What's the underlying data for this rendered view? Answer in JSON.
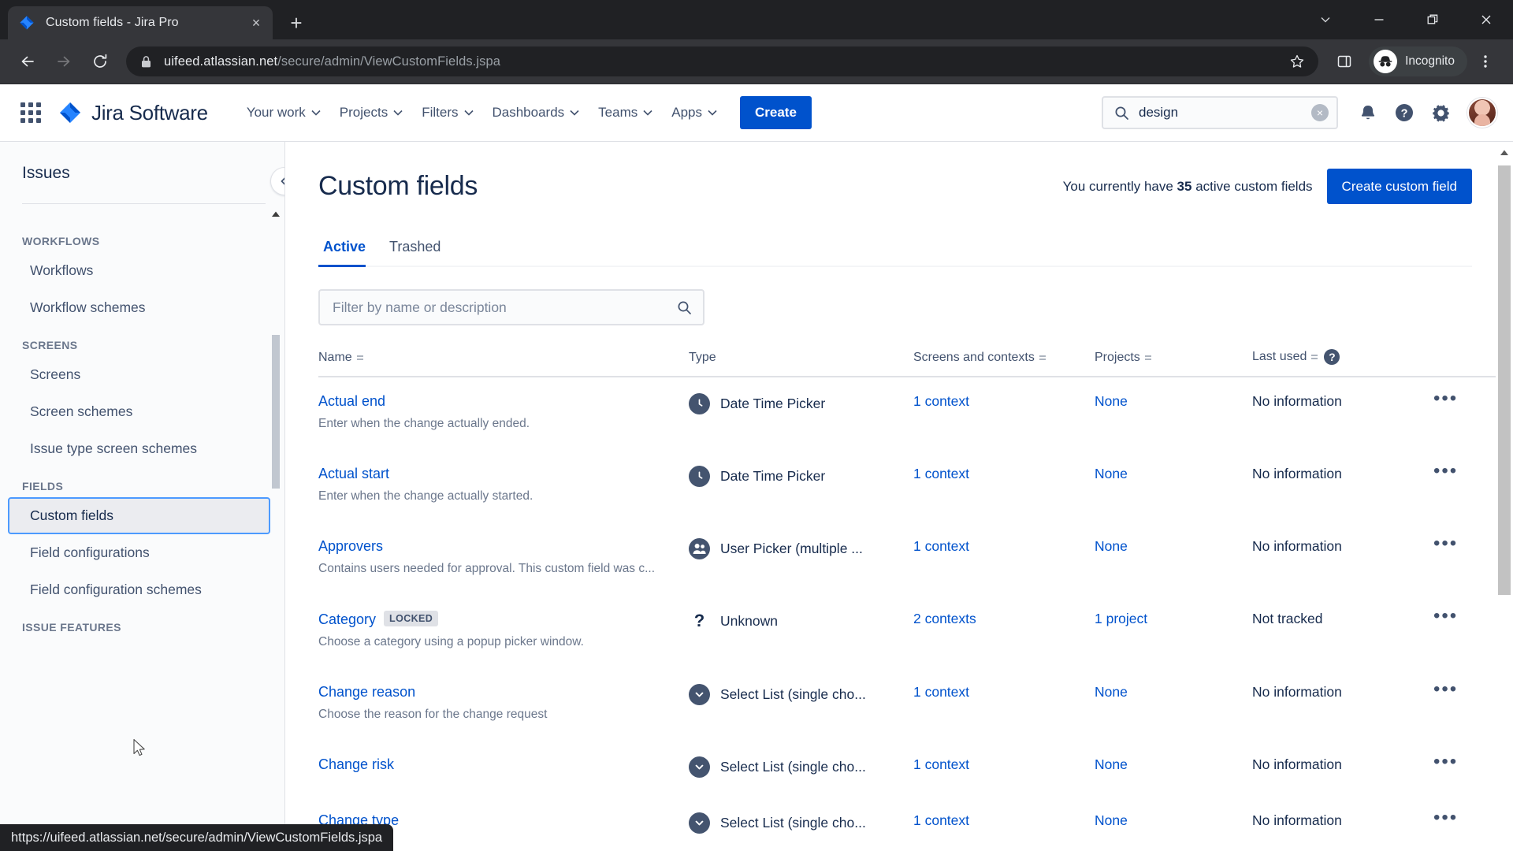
{
  "browser": {
    "tab": {
      "title": "Custom fields - Jira Pro",
      "favicon": "jira-favicon",
      "close": "×"
    },
    "new_tab_label": "+",
    "window_controls": [
      "chevron-down",
      "minimize",
      "restore",
      "close"
    ],
    "url_domain": "uifeed.atlassian.net",
    "url_path": "/secure/admin/ViewCustomFields.jspa",
    "profile_label": "Incognito",
    "status_url": "https://uifeed.atlassian.net/secure/admin/ViewCustomFields.jspa"
  },
  "jira_header": {
    "brand": "Jira Software",
    "nav": [
      {
        "label": "Your work",
        "has_chevron": true
      },
      {
        "label": "Projects",
        "has_chevron": true
      },
      {
        "label": "Filters",
        "has_chevron": true
      },
      {
        "label": "Dashboards",
        "has_chevron": true
      },
      {
        "label": "Teams",
        "has_chevron": true
      },
      {
        "label": "Apps",
        "has_chevron": true
      }
    ],
    "create_label": "Create",
    "search": {
      "value": "design",
      "icon": "search-icon",
      "clear": "×"
    },
    "icons": [
      "notifications-icon",
      "help-icon",
      "settings-icon",
      "avatar"
    ]
  },
  "sidebar": {
    "title": "Issues",
    "sections": [
      {
        "label": "WORKFLOWS",
        "items": [
          {
            "label": "Workflows",
            "selected": false
          },
          {
            "label": "Workflow schemes",
            "selected": false
          }
        ]
      },
      {
        "label": "SCREENS",
        "items": [
          {
            "label": "Screens",
            "selected": false
          },
          {
            "label": "Screen schemes",
            "selected": false
          },
          {
            "label": "Issue type screen schemes",
            "selected": false
          }
        ]
      },
      {
        "label": "FIELDS",
        "items": [
          {
            "label": "Custom fields",
            "selected": true
          },
          {
            "label": "Field configurations",
            "selected": false
          },
          {
            "label": "Field configuration schemes",
            "selected": false
          }
        ]
      },
      {
        "label": "ISSUE FEATURES",
        "items": []
      }
    ]
  },
  "main": {
    "page_title": "Custom fields",
    "count_prefix": "You currently have",
    "count_value": "35",
    "count_suffix": "active custom fields",
    "create_custom_field_label": "Create custom field",
    "tabs": [
      {
        "label": "Active",
        "active": true
      },
      {
        "label": "Trashed",
        "active": false
      }
    ],
    "filter_placeholder": "Filter by name or description",
    "filter_value": "",
    "columns": [
      {
        "label": "Name",
        "sortable": true
      },
      {
        "label": "Type",
        "sortable": false
      },
      {
        "label": "Screens and contexts",
        "sortable": true
      },
      {
        "label": "Projects",
        "sortable": true
      },
      {
        "label": "Last used",
        "sortable": true,
        "help": true
      },
      {
        "label": "",
        "sortable": false
      }
    ],
    "rows": [
      {
        "name": "Actual end",
        "badge": "",
        "description": "Enter when the change actually ended.",
        "type": "Date Time Picker",
        "type_icon": "clock-icon",
        "contexts": "1 context",
        "projects": "None",
        "last_used": "No information",
        "actions": "•••"
      },
      {
        "name": "Actual start",
        "badge": "",
        "description": "Enter when the change actually started.",
        "type": "Date Time Picker",
        "type_icon": "clock-icon",
        "contexts": "1 context",
        "projects": "None",
        "last_used": "No information",
        "actions": "•••"
      },
      {
        "name": "Approvers",
        "badge": "",
        "description": "Contains users needed for approval. This custom field was c...",
        "type": "User Picker (multiple ...",
        "type_icon": "users-icon",
        "contexts": "1 context",
        "projects": "None",
        "last_used": "No information",
        "actions": "•••"
      },
      {
        "name": "Category",
        "badge": "LOCKED",
        "description": "Choose a category using a popup picker window.",
        "type": "Unknown",
        "type_icon": "question-icon",
        "contexts": "2 contexts",
        "projects": "1 project",
        "last_used": "Not tracked",
        "actions": "•••"
      },
      {
        "name": "Change reason",
        "badge": "",
        "description": "Choose the reason for the change request",
        "type": "Select List (single cho...",
        "type_icon": "chevron-down-circle-icon",
        "contexts": "1 context",
        "projects": "None",
        "last_used": "No information",
        "actions": "•••"
      },
      {
        "name": "Change risk",
        "badge": "",
        "description": "",
        "type": "Select List (single cho...",
        "type_icon": "chevron-down-circle-icon",
        "contexts": "1 context",
        "projects": "None",
        "last_used": "No information",
        "actions": "•••"
      },
      {
        "name": "Change type",
        "badge": "",
        "description": "",
        "type": "Select List (single cho...",
        "type_icon": "chevron-down-circle-icon",
        "contexts": "1 context",
        "projects": "None",
        "last_used": "No information",
        "actions": "•••"
      }
    ]
  },
  "colors": {
    "brand_blue": "#0052cc",
    "link_blue": "#0052cc",
    "text_dark": "#172b4d",
    "text_muted": "#6b778c",
    "icon_navy": "#44546f",
    "selected_bg": "#ebecf0",
    "selected_border": "#4c9aff"
  }
}
